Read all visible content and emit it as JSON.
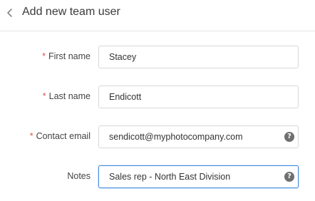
{
  "header": {
    "back_icon": "chevron-left-icon",
    "title": "Add new team user"
  },
  "form": {
    "required_marker": "*",
    "fields": [
      {
        "label": "First name",
        "value": "Stacey",
        "required": true
      },
      {
        "label": "Last name",
        "value": "Endicott",
        "required": true
      },
      {
        "label": "Contact email",
        "value": "sendicott@myphotocompany.com",
        "required": true,
        "help_icon": "question-circle-icon",
        "help_glyph": "?"
      },
      {
        "label": "Notes",
        "value": "Sales rep - North East Division",
        "required": false,
        "help_icon": "question-circle-icon",
        "help_glyph": "?",
        "focused": true
      }
    ]
  },
  "colors": {
    "required": "#d9534f",
    "focus_border": "#4a90e2",
    "help_icon_bg": "#6f6f6f"
  }
}
